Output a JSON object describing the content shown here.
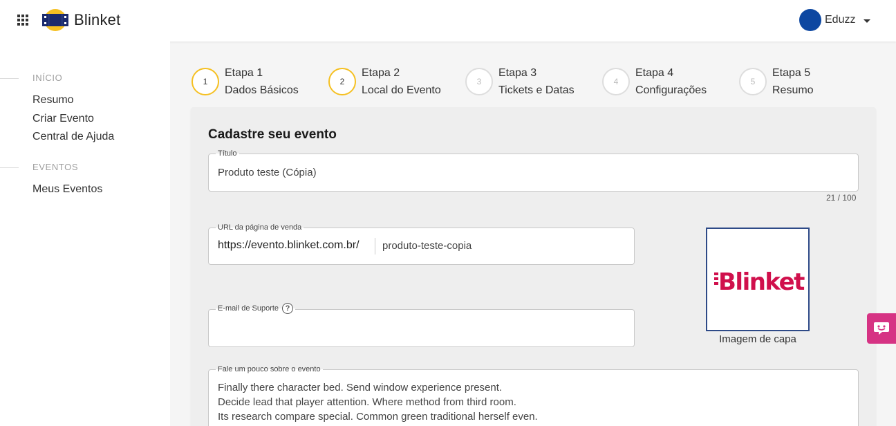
{
  "header": {
    "brand": "Blinket",
    "user_name": "Eduzz",
    "avatar_color": "#0d47a1"
  },
  "sidebar": {
    "sections": [
      {
        "title": "INÍCIO",
        "items": [
          "Resumo",
          "Criar Evento",
          "Central de Ajuda"
        ]
      },
      {
        "title": "EVENTOS",
        "items": [
          "Meus Eventos"
        ]
      }
    ]
  },
  "stepper": {
    "steps": [
      {
        "number": "1",
        "title": "Etapa 1",
        "label": "Dados Básicos",
        "active": true
      },
      {
        "number": "2",
        "title": "Etapa 2",
        "label": "Local do Evento",
        "active": true
      },
      {
        "number": "3",
        "title": "Etapa 3",
        "label": "Tickets e Datas",
        "active": false
      },
      {
        "number": "4",
        "title": "Etapa 4",
        "label": "Configurações",
        "active": false
      },
      {
        "number": "5",
        "title": "Etapa 5",
        "label": "Resumo",
        "active": false
      }
    ]
  },
  "form": {
    "heading": "Cadastre seu evento",
    "title_field": {
      "label": "Título",
      "value": "Produto teste (Cópia)",
      "counter": "21 / 100"
    },
    "url_field": {
      "label": "URL da página de venda",
      "prefix": "https://evento.blinket.com.br/",
      "slug": "produto-teste-copia"
    },
    "email_field": {
      "label": "E-mail de Suporte",
      "help": "?",
      "value": ""
    },
    "cover": {
      "logo_text": "Blinket",
      "caption": "Imagem de capa",
      "logo_color": "#d0104c"
    },
    "description_field": {
      "label": "Fale um pouco sobre o evento",
      "lines": [
        "Finally there character bed. Send window experience present.",
        "Decide lead that player attention. Where method from third room.",
        "Its research compare special. Common green traditional herself even."
      ]
    }
  },
  "colors": {
    "step_active": "#f5c022",
    "chat_button": "#d63384"
  },
  "icons": {
    "apps": "grid-icon",
    "chat": "chat-icon",
    "help": "help-icon"
  }
}
